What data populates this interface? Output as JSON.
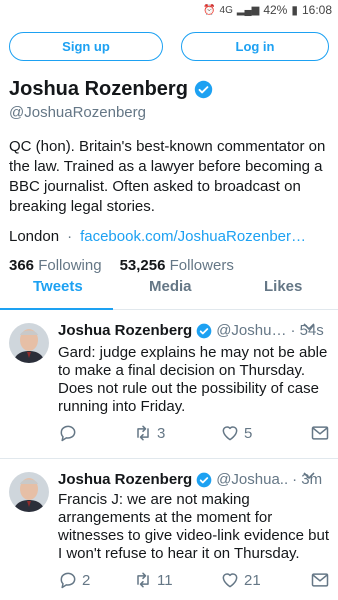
{
  "status_bar": {
    "battery": "42%",
    "time": "16:08",
    "network": "4G"
  },
  "auth": {
    "signup_label": "Sign up",
    "login_label": "Log in"
  },
  "profile": {
    "name": "Joshua Rozenberg",
    "handle": "@JoshuaRozenberg",
    "bio": "QC (hon). Britain's best-known commentator on the law. Trained as a lawyer before becoming a BBC journalist. Often asked to broadcast on breaking legal stories.",
    "location": "London",
    "link": "facebook.com/JoshuaRozenber…",
    "following_count": "366",
    "following_label": "Following",
    "followers_count": "53,256",
    "followers_label": "Followers"
  },
  "tabs": [
    {
      "label": "Tweets",
      "active": true
    },
    {
      "label": "Media",
      "active": false
    },
    {
      "label": "Likes",
      "active": false
    }
  ],
  "tweets": [
    {
      "name": "Joshua Rozenberg",
      "handle": "@Joshu…",
      "time": "· 54s",
      "text": "Gard: judge explains he may not be able to make a final decision on Thursday. Does not rule out the possibility of case running into Friday.",
      "replies": "",
      "retweets": "3",
      "likes": "5"
    },
    {
      "name": "Joshua Rozenberg",
      "handle": "@Joshua..",
      "time": "· 3m",
      "text": "Francis J: we are not making arrangements at the moment for witnesses to give video-link evidence but I won't refuse to hear it on Thursday.",
      "replies": "2",
      "retweets": "11",
      "likes": "21"
    }
  ],
  "colors": {
    "accent": "#1da1f2",
    "muted": "#657786",
    "text": "#14171a"
  }
}
